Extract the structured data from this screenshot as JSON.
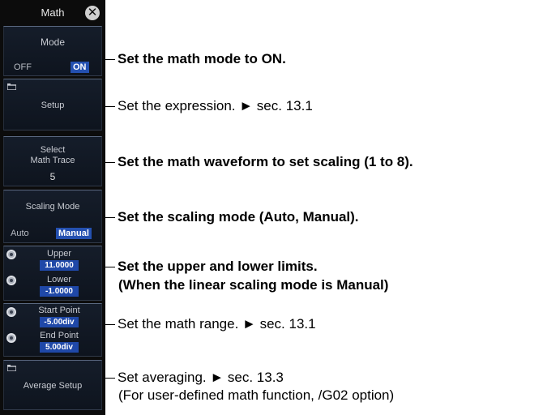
{
  "panel": {
    "title": "Math",
    "close_icon": "close-icon",
    "mode": {
      "label": "Mode",
      "off": "OFF",
      "on": "ON"
    },
    "setup": {
      "icon": "folder-icon",
      "label": "Setup"
    },
    "select_trace": {
      "label_line1": "Select",
      "label_line2": "Math Trace",
      "value": "5"
    },
    "scaling_mode": {
      "label": "Scaling Mode",
      "auto": "Auto",
      "manual": "Manual"
    },
    "limits": {
      "upper_label": "Upper",
      "upper_value": "11.0000",
      "lower_label": "Lower",
      "lower_value": "-1.0000"
    },
    "range": {
      "start_label": "Start Point",
      "start_value": "-5.00div",
      "end_label": "End Point",
      "end_value": "5.00div"
    },
    "average": {
      "icon": "folder-icon",
      "label": "Average Setup"
    }
  },
  "annotations": {
    "mode": "Set the math mode to ON.",
    "setup": "Set the expression. ► sec. 13.1",
    "select": "Set the math waveform to set scaling (1 to 8).",
    "scaling": "Set the scaling mode (Auto, Manual).",
    "limits_line1": "Set the upper and lower limits.",
    "limits_line2": "(When the linear scaling mode is Manual)",
    "range": "Set the math range. ► sec. 13.1",
    "average_line1": "Set averaging. ► sec. 13.3",
    "average_line2": "(For user-defined math function, /G02 option)"
  },
  "colors": {
    "panel_bg": "#0c0c0c",
    "block_bg": "#131a26",
    "selected": "#2450b0",
    "text_light": "#c8cbd2"
  }
}
